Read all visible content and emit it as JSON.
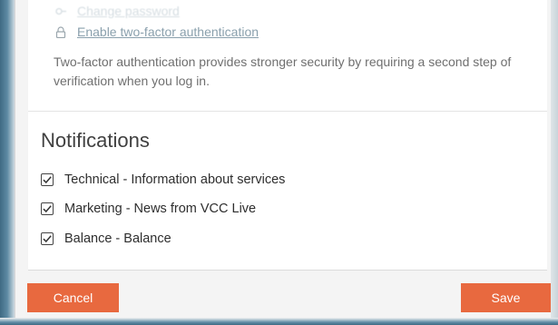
{
  "security": {
    "change_password_label": "Change password",
    "two_factor_link_label": "Enable two-factor authentication",
    "two_factor_description": "Two-factor authentication provides stronger security by requiring a second step of verification when you log in."
  },
  "notifications": {
    "title": "Notifications",
    "items": [
      {
        "label": "Technical - Information about services",
        "checked": true
      },
      {
        "label": "Marketing - News from VCC Live",
        "checked": true
      },
      {
        "label": "Balance - Balance",
        "checked": true
      }
    ]
  },
  "footer": {
    "cancel_label": "Cancel",
    "save_label": "Save"
  },
  "colors": {
    "accent": "#e8693f",
    "link": "#8aa0ad",
    "backdrop": "#3f6a83"
  }
}
